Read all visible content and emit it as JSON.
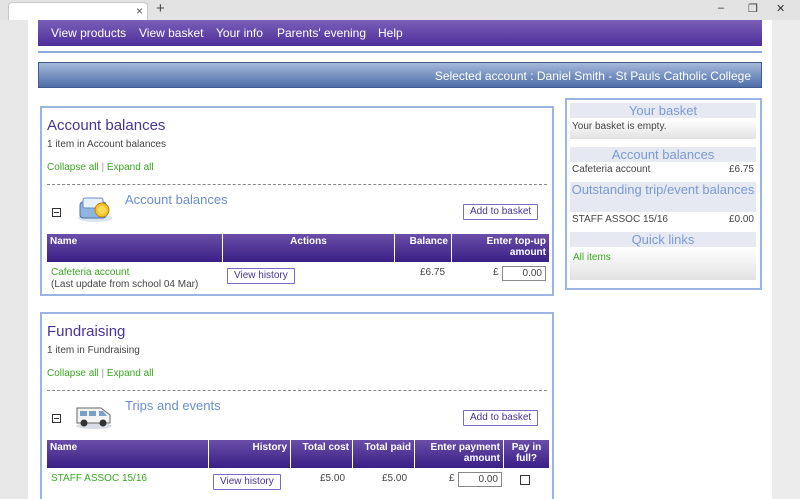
{
  "browser": {
    "tab_close": "×",
    "new_tab": "+",
    "minimize": "–",
    "restore": "❐",
    "close": "✕"
  },
  "nav": [
    "View products",
    "View basket",
    "Your info",
    "Parents' evening",
    "Help"
  ],
  "selected_account": "Selected account : Daniel Smith - St Pauls Catholic College",
  "account_balances": {
    "heading": "Account balances",
    "count_text": "1 item in Account balances",
    "collapse_all": "Collapse all",
    "separator": "|",
    "expand_all": "Expand all",
    "section_title": "Account balances",
    "add_to_basket": "Add to basket",
    "columns": [
      "Name",
      "Actions",
      "Balance",
      "Enter top-up amount"
    ],
    "row": {
      "name": "Cafeteria account",
      "note": "(Last update from school 04 Mar)",
      "action": "View history",
      "balance": "£6.75",
      "currency": "£",
      "amount": "0.00"
    }
  },
  "fundraising": {
    "heading": "Fundraising",
    "count_text": "1 item in Fundraising",
    "collapse_all": "Collapse all",
    "separator": "|",
    "expand_all": "Expand all",
    "section_title": "Trips and events",
    "add_to_basket": "Add to basket",
    "columns": [
      "Name",
      "History",
      "Total cost",
      "Total paid",
      "Enter payment amount",
      "Pay in full?"
    ],
    "row": {
      "name": "STAFF ASSOC 15/16",
      "history": "View history",
      "total_cost": "£5.00",
      "total_paid": "£5.00",
      "currency": "£",
      "amount": "0.00"
    }
  },
  "sidebar": {
    "basket_title": "Your basket",
    "basket_text": "Your basket is empty.",
    "balances_title": "Account balances",
    "balance_name": "Cafeteria account",
    "balance_value": "£6.75",
    "outstanding_title": "Outstanding trip/event balances",
    "outstanding_name": "STAFF ASSOC 15/16",
    "outstanding_value": "£0.00",
    "quick_links_title": "Quick links",
    "all_items": "All items"
  }
}
